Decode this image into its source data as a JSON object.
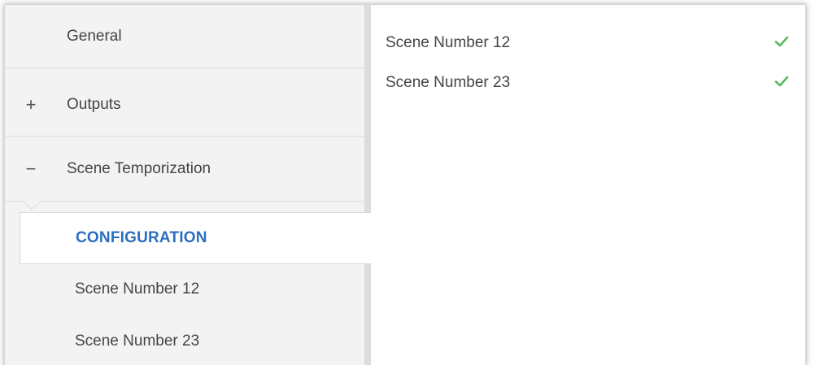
{
  "sidebar": {
    "items": [
      {
        "label": "General",
        "sign": ""
      },
      {
        "label": "Outputs",
        "sign": "+"
      },
      {
        "label": "Scene Temporization",
        "sign": "−"
      }
    ],
    "subitems": [
      {
        "label": "CONFIGURATION",
        "active": true
      },
      {
        "label": "Scene Number 12"
      },
      {
        "label": "Scene Number 23"
      }
    ]
  },
  "content": {
    "params": [
      {
        "label": "Scene Number 12",
        "checked": true,
        "icon": "checkmark-icon"
      },
      {
        "label": "Scene Number 23",
        "checked": true,
        "icon": "checkmark-icon"
      }
    ]
  },
  "colors": {
    "accent": "#2a6fbf",
    "check": "#5cb85c",
    "sidebar_bg": "#f3f3f3"
  }
}
